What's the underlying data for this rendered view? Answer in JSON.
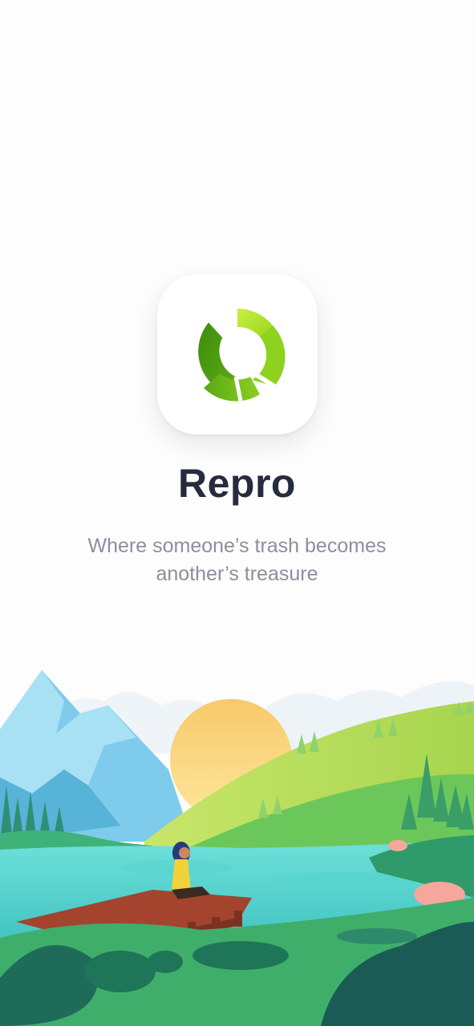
{
  "app": {
    "name": "Repro",
    "tagline": "Where someone’s trash becomes another’s treasure",
    "logo_icon": "recycle-arrows-icon",
    "illustration": "lake-landscape-illustration"
  },
  "colors": {
    "title": "#262c3d",
    "tagline": "#8c8f9e",
    "logo_green_dark": "#4a9d0f",
    "logo_green_light": "#a6de2b",
    "background": "#fdfdfd"
  }
}
